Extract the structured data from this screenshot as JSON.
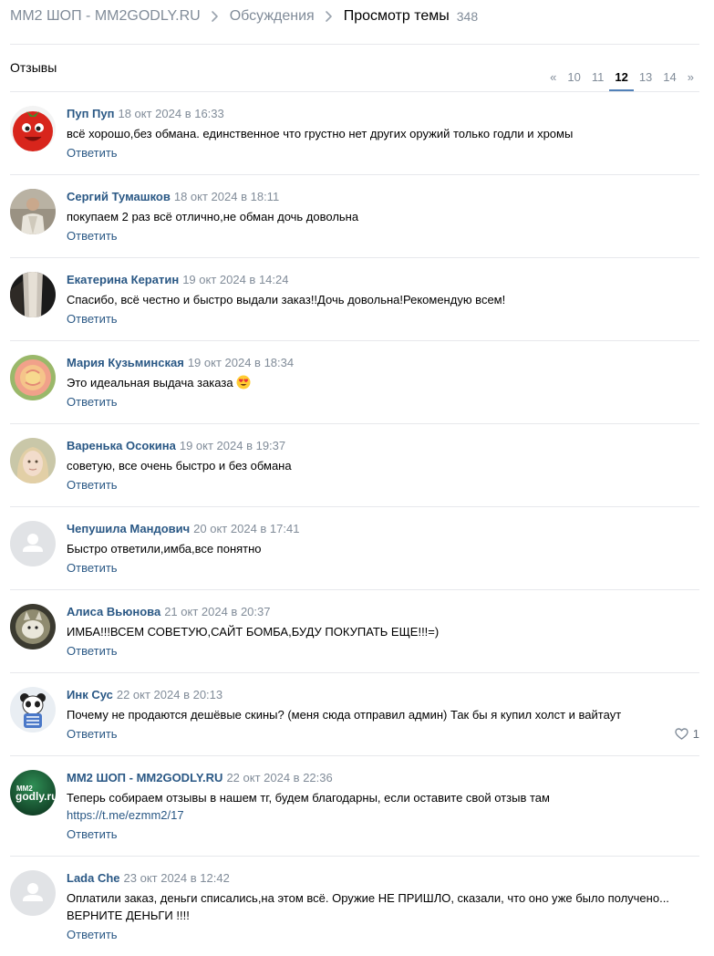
{
  "breadcrumbs": {
    "group": "MM2 ШОП - MM2GODLY.RU",
    "discussions": "Обсуждения",
    "current": "Просмотр темы",
    "count": "348"
  },
  "section_title": "Отзывы",
  "pagination": {
    "prev": "«",
    "pages": [
      "10",
      "11",
      "12",
      "13",
      "14"
    ],
    "current": "12",
    "next": "»"
  },
  "reply_label": "Ответить",
  "posts": [
    {
      "author": "Пуп Пуп",
      "date": "18 окт 2024 в 16:33",
      "text": "всё хорошо,без обмана. единственное что грустно нет других оружий только годли и хромы",
      "avatar": "tomato-face"
    },
    {
      "author": "Сергий Тумашков",
      "date": "18 окт 2024 в 18:11",
      "text": "покупаем 2 раз всё отлично,не обман дочь довольна",
      "avatar": "man-photo"
    },
    {
      "author": "Екатерина Кератин",
      "date": "19 окт 2024 в 14:24",
      "text": "Спасибо, всё честно и быстро выдали заказ!!Дочь довольна!Рекомендую всем!",
      "avatar": "hair-photo"
    },
    {
      "author": "Мария Кузьминская",
      "date": "19 окт 2024 в 18:34",
      "text": "Это идеальная выдача заказа",
      "avatar": "rose-photo",
      "emoji": "heart-eyes-emoji"
    },
    {
      "author": "Варенька Осокина",
      "date": "19 окт 2024 в 19:37",
      "text": "советую, все очень быстро и без обмана",
      "avatar": "girl-photo"
    },
    {
      "author": "Чепушила Мандович",
      "date": "20 окт 2024 в 17:41",
      "text": "Быстро ответили,имба,все понятно",
      "avatar": "default-user"
    },
    {
      "author": "Алиса Вьюнова",
      "date": "21 окт 2024 в 20:37",
      "text": "ИМБА!!!ВСЕМ СОВЕТУЮ,САЙТ БОМБА,БУДУ ПОКУПАТЬ ЕЩЕ!!!=)",
      "avatar": "cat-photo"
    },
    {
      "author": "Инк Сус",
      "date": "22 окт 2024 в 20:13",
      "text": "Почему не продаются дешёвые скины? (меня сюда отправил админ) Так бы я купил холст и вайтаут",
      "avatar": "panda-skeleton",
      "likes": "1"
    },
    {
      "author": "MM2 ШОП - MM2GODLY.RU",
      "date": "22 окт 2024 в 22:36",
      "text": "Теперь собираем отзывы в нашем тг, будем благодарны, если оставите свой отзыв там",
      "link": "https://t.me/ezmm2/17",
      "avatar": "mm2godly-logo",
      "avatar_logo_text": "MM2\ngodly.ru"
    },
    {
      "author": "Lada Che",
      "date": "23 окт 2024 в 12:42",
      "text": "Оплатили заказ, деньги списались,на этом всё. Оружие НЕ ПРИШЛО, сказали, что оно уже было получено...\nВЕРНИТЕ ДЕНЬГИ !!!!",
      "avatar": "default-user"
    }
  ],
  "colors": {
    "link": "#2a5885",
    "muted": "#818c99",
    "divider": "#e7e8ec",
    "accent": "#5181b8"
  }
}
